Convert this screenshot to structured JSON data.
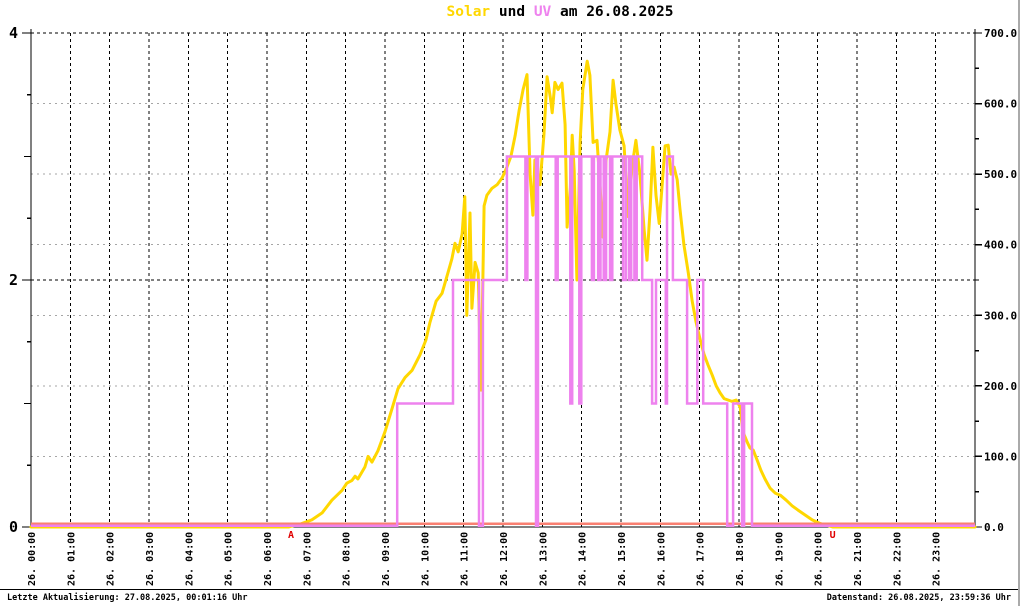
{
  "title": {
    "solar": "Solar",
    "und": " und ",
    "uv": "UV",
    "date": " am 26.08.2025"
  },
  "footer": {
    "left": "Letzte Aktualisierung: 27.08.2025, 00:01:16 Uhr",
    "right": "Datenstand: 26.08.2025, 23:59:36 Uhr"
  },
  "colors": {
    "solar": "#FFD700",
    "uv": "#EE82EE",
    "zero_line": "#FA8072",
    "marker": "#E00000",
    "grid_major": "#000000",
    "grid_minor": "#A6A6A6",
    "axis": "#000000"
  },
  "axes": {
    "left_tick_labels": [
      "4",
      "2",
      "0"
    ],
    "left_tick_values": [
      4,
      2,
      0
    ],
    "right_tick_labels": [
      "700.0",
      "600.0",
      "500.0",
      "400.0",
      "300.0",
      "200.0",
      "100.0",
      "0.0"
    ],
    "right_tick_values": [
      700,
      600,
      500,
      400,
      300,
      200,
      100,
      0
    ],
    "x_tick_labels": [
      "26. 00:00",
      "26. 01:00",
      "26. 02:00",
      "26. 03:00",
      "26. 04:00",
      "26. 05:00",
      "26. 06:00",
      "26. 07:00",
      "26. 08:00",
      "26. 09:00",
      "26. 10:00",
      "26. 11:00",
      "26. 12:00",
      "26. 13:00",
      "26. 14:00",
      "26. 15:00",
      "26. 16:00",
      "26. 17:00",
      "26. 18:00",
      "26. 19:00",
      "26. 20:00",
      "26. 21:00",
      "26. 22:00",
      "26. 23:00"
    ]
  },
  "chart_data": {
    "type": "line",
    "title": "Solar und UV am 26.08.2025",
    "x_unit": "hours",
    "x_range": [
      0,
      24
    ],
    "y_left": {
      "range": [
        0,
        4
      ],
      "series": "UV"
    },
    "y_right": {
      "range": [
        0,
        700
      ],
      "series": "Solar"
    },
    "grid": {
      "vertical_hours": true,
      "horizontal_gray_every": 100,
      "horizontal_black_at": [
        350,
        700
      ]
    },
    "markers": {
      "sunrise": {
        "label": "A",
        "time": 6.61
      },
      "sunset": {
        "label": "U",
        "time": 20.38
      }
    },
    "zero_reference_line": {
      "value": 0,
      "color": "#FA8072"
    },
    "series": [
      {
        "name": "Solar",
        "axis": "right",
        "color": "#FFD700",
        "points": [
          [
            0,
            0
          ],
          [
            6.55,
            0
          ],
          [
            6.61,
            1
          ],
          [
            6.84,
            4
          ],
          [
            7.14,
            10
          ],
          [
            7.4,
            20
          ],
          [
            7.65,
            38
          ],
          [
            7.91,
            52
          ],
          [
            8.03,
            62
          ],
          [
            8.16,
            66
          ],
          [
            8.24,
            72
          ],
          [
            8.31,
            68
          ],
          [
            8.49,
            85
          ],
          [
            8.57,
            100
          ],
          [
            8.67,
            92
          ],
          [
            8.82,
            108
          ],
          [
            9.0,
            135
          ],
          [
            9.18,
            168
          ],
          [
            9.33,
            196
          ],
          [
            9.51,
            212
          ],
          [
            9.69,
            222
          ],
          [
            9.89,
            244
          ],
          [
            10.04,
            265
          ],
          [
            10.14,
            289
          ],
          [
            10.3,
            320
          ],
          [
            10.45,
            331
          ],
          [
            10.6,
            360
          ],
          [
            10.7,
            380
          ],
          [
            10.78,
            402
          ],
          [
            10.86,
            390
          ],
          [
            10.96,
            415
          ],
          [
            11.03,
            468
          ],
          [
            11.08,
            300
          ],
          [
            11.16,
            445
          ],
          [
            11.21,
            310
          ],
          [
            11.29,
            375
          ],
          [
            11.37,
            360
          ],
          [
            11.44,
            194
          ],
          [
            11.52,
            455
          ],
          [
            11.59,
            470
          ],
          [
            11.72,
            480
          ],
          [
            11.85,
            485
          ],
          [
            11.98,
            495
          ],
          [
            12.1,
            510
          ],
          [
            12.2,
            525
          ],
          [
            12.31,
            555
          ],
          [
            12.41,
            590
          ],
          [
            12.51,
            620
          ],
          [
            12.61,
            641
          ],
          [
            12.69,
            500
          ],
          [
            12.76,
            442
          ],
          [
            12.81,
            520
          ],
          [
            12.94,
            485
          ],
          [
            13.04,
            555
          ],
          [
            13.12,
            638
          ],
          [
            13.2,
            610
          ],
          [
            13.25,
            587
          ],
          [
            13.32,
            630
          ],
          [
            13.4,
            620
          ],
          [
            13.5,
            629
          ],
          [
            13.58,
            570
          ],
          [
            13.63,
            425
          ],
          [
            13.71,
            480
          ],
          [
            13.76,
            555
          ],
          [
            13.81,
            505
          ],
          [
            13.88,
            350
          ],
          [
            13.96,
            545
          ],
          [
            14.03,
            620
          ],
          [
            14.14,
            660
          ],
          [
            14.21,
            640
          ],
          [
            14.29,
            545
          ],
          [
            14.39,
            548
          ],
          [
            14.47,
            480
          ],
          [
            14.54,
            411
          ],
          [
            14.62,
            520
          ],
          [
            14.72,
            560
          ],
          [
            14.8,
            633
          ],
          [
            14.87,
            600
          ],
          [
            14.97,
            563
          ],
          [
            15.08,
            540
          ],
          [
            15.18,
            440
          ],
          [
            15.28,
            510
          ],
          [
            15.38,
            548
          ],
          [
            15.48,
            500
          ],
          [
            15.59,
            420
          ],
          [
            15.66,
            378
          ],
          [
            15.74,
            450
          ],
          [
            15.81,
            538
          ],
          [
            15.89,
            470
          ],
          [
            15.97,
            430
          ],
          [
            16.04,
            480
          ],
          [
            16.12,
            540
          ],
          [
            16.2,
            541
          ],
          [
            16.27,
            500
          ],
          [
            16.35,
            510
          ],
          [
            16.43,
            492
          ],
          [
            16.5,
            450
          ],
          [
            16.6,
            400
          ],
          [
            16.71,
            360
          ],
          [
            16.81,
            320
          ],
          [
            16.91,
            290
          ],
          [
            17.01,
            266
          ],
          [
            17.11,
            245
          ],
          [
            17.21,
            230
          ],
          [
            17.32,
            215
          ],
          [
            17.42,
            200
          ],
          [
            17.52,
            190
          ],
          [
            17.62,
            182
          ],
          [
            17.72,
            180
          ],
          [
            17.82,
            178
          ],
          [
            17.93,
            180
          ],
          [
            18.03,
            170
          ],
          [
            18.1,
            135
          ],
          [
            18.21,
            120
          ],
          [
            18.28,
            112
          ],
          [
            18.36,
            109
          ],
          [
            18.46,
            95
          ],
          [
            18.56,
            80
          ],
          [
            18.66,
            68
          ],
          [
            18.79,
            55
          ],
          [
            18.92,
            48
          ],
          [
            19.05,
            45
          ],
          [
            19.2,
            38
          ],
          [
            19.35,
            30
          ],
          [
            19.5,
            24
          ],
          [
            19.68,
            17
          ],
          [
            19.86,
            10
          ],
          [
            20.06,
            5
          ],
          [
            20.26,
            2
          ],
          [
            20.39,
            0
          ],
          [
            24,
            0
          ]
        ]
      },
      {
        "name": "UV",
        "axis": "left",
        "color": "#EE82EE",
        "step_points": [
          [
            0,
            0
          ],
          [
            9.31,
            1
          ],
          [
            10.73,
            2
          ],
          [
            11.39,
            0
          ],
          [
            11.49,
            2
          ],
          [
            12.1,
            3
          ],
          [
            12.57,
            2
          ],
          [
            12.62,
            3
          ],
          [
            12.84,
            0
          ],
          [
            12.89,
            3
          ],
          [
            13.34,
            2
          ],
          [
            13.39,
            3
          ],
          [
            13.71,
            1
          ],
          [
            13.76,
            3
          ],
          [
            13.94,
            1
          ],
          [
            13.99,
            3
          ],
          [
            14.26,
            2
          ],
          [
            14.31,
            3
          ],
          [
            14.42,
            2
          ],
          [
            14.48,
            3
          ],
          [
            14.56,
            2
          ],
          [
            14.62,
            3
          ],
          [
            14.72,
            2
          ],
          [
            14.78,
            3
          ],
          [
            15.05,
            2
          ],
          [
            15.12,
            3
          ],
          [
            15.2,
            2
          ],
          [
            15.26,
            3
          ],
          [
            15.34,
            2
          ],
          [
            15.4,
            3
          ],
          [
            15.54,
            2
          ],
          [
            15.79,
            1
          ],
          [
            15.89,
            2
          ],
          [
            16.14,
            1
          ],
          [
            16.17,
            3
          ],
          [
            16.32,
            2
          ],
          [
            16.68,
            1
          ],
          [
            16.94,
            2
          ],
          [
            17.09,
            1
          ],
          [
            17.7,
            0
          ],
          [
            17.85,
            1
          ],
          [
            18.08,
            0
          ],
          [
            18.13,
            1
          ],
          [
            18.33,
            0
          ]
        ]
      }
    ]
  }
}
